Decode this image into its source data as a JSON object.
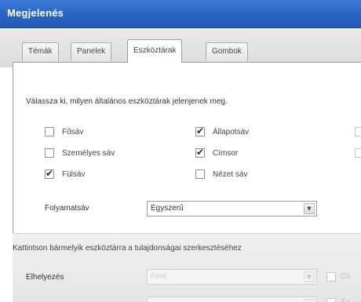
{
  "window": {
    "title": "Megjelenés"
  },
  "tabs": [
    {
      "label": "Témák"
    },
    {
      "label": "Panelek"
    },
    {
      "label": "Eszköztárak"
    },
    {
      "label": "Gombok"
    }
  ],
  "toolbars": {
    "description": "Válassza ki, milyen általános eszköztárak jelenjenek meg.",
    "items": [
      {
        "label": "Fősáv",
        "checked": false
      },
      {
        "label": "Állapotsáv",
        "checked": true
      },
      {
        "label": "Személyes sáv",
        "checked": false
      },
      {
        "label": "Címsor",
        "checked": true
      },
      {
        "label": "Fülsáv",
        "checked": true
      },
      {
        "label": "Nézet sáv",
        "checked": false
      }
    ],
    "progress_label": "Folyamatsáv",
    "progress_value": "Egyszerű"
  },
  "properties": {
    "hint": "Kattintson bármelyik eszköztárra a tulajdonságai szerkesztéséhez",
    "placement_label": "Elhelyezés",
    "placement_value": "Fent",
    "placement_check_text": "Cs",
    "second_check_text": "Sz"
  }
}
